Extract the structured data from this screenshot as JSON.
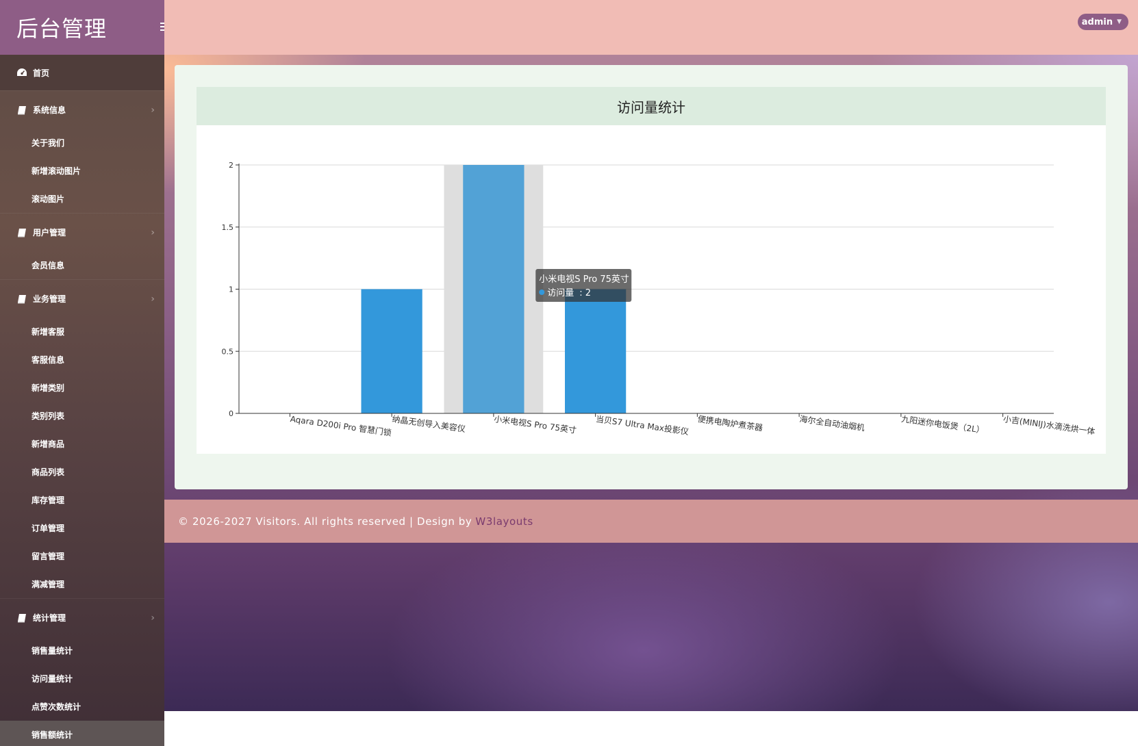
{
  "brand": {
    "title": "后台管理"
  },
  "header": {
    "user_label": "admin"
  },
  "sidebar": {
    "home": {
      "label": "首页",
      "icon": "dashboard-icon"
    },
    "sections": [
      {
        "label": "系统信息",
        "icon": "book-icon",
        "items": [
          "关于我们",
          "新增滚动图片",
          "滚动图片"
        ]
      },
      {
        "label": "用户管理",
        "icon": "book-icon",
        "items": [
          "会员信息"
        ]
      },
      {
        "label": "业务管理",
        "icon": "book-icon",
        "items": [
          "新增客服",
          "客服信息",
          "新增类别",
          "类别列表",
          "新增商品",
          "商品列表",
          "库存管理",
          "订单管理",
          "留言管理",
          "满减管理"
        ]
      },
      {
        "label": "统计管理",
        "icon": "book-icon",
        "items": [
          "销售量统计",
          "访问量统计",
          "点赞次数统计",
          "销售额统计"
        ]
      }
    ],
    "active_item": "销售额统计"
  },
  "chart_card": {
    "title": "访问量统计"
  },
  "chart_data": {
    "type": "bar",
    "title": "访问量统计",
    "categories": [
      "Aqara D200i Pro 智慧门锁",
      "纳晶无创导入美容仪",
      "小米电视S Pro 75英寸",
      "当贝S7 Ultra Max投影仪",
      "便携电陶炉煮茶器",
      "海尔全自动油烟机",
      "九阳迷你电饭煲（2L）",
      "小吉(MINIJ)水滴洗烘一体"
    ],
    "series": [
      {
        "name": "访问量",
        "values": [
          0,
          1,
          2,
          1,
          0,
          0,
          0,
          0
        ]
      }
    ],
    "ylim": [
      0,
      2
    ],
    "yticks": [
      "0",
      "0.5",
      "1",
      "1.5",
      "2"
    ],
    "grid": true,
    "bar_color": "#3398db",
    "highlight_color": "#52a2d6",
    "hover_index": 2,
    "tooltip": {
      "title": "小米电视S Pro 75英寸",
      "series_label": "访问量",
      "value": "2"
    }
  },
  "footer": {
    "text": "© 2026-2027 Visitors. All rights reserved | Design by",
    "link": "W3layouts"
  }
}
